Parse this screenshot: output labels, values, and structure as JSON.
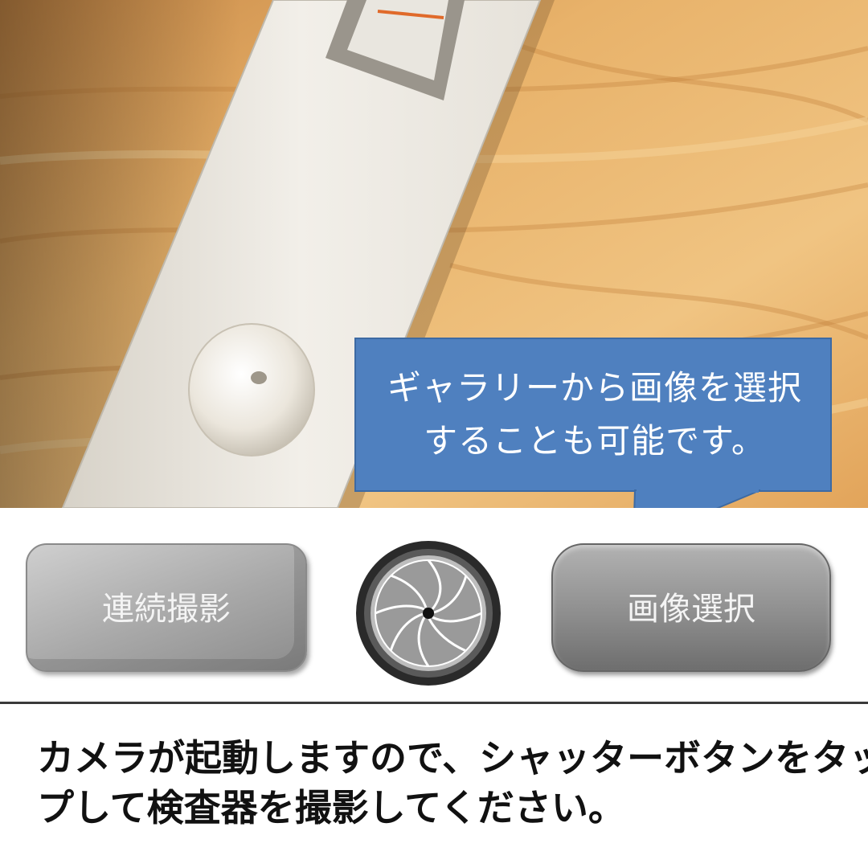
{
  "callout": {
    "lines": [
      "ギャラリーから画像を選択",
      "することも可能です。"
    ]
  },
  "controls": {
    "burst_label": "連続撮影",
    "gallery_label": "画像選択",
    "shutter_icon": "camera-shutter-icon"
  },
  "instruction": {
    "lines": [
      "カメラが起動しますので、シャッターボタンをタッ",
      "プして検査器を撮影してください。"
    ]
  },
  "colors": {
    "callout": "#4f80bf",
    "button_gray": "#9a9a9a",
    "wood": "#e0a860"
  }
}
